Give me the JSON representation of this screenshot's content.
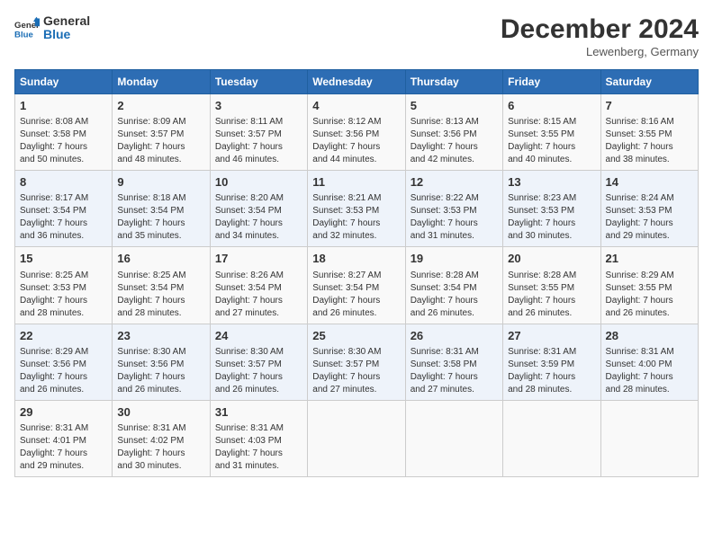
{
  "header": {
    "logo_line1": "General",
    "logo_line2": "Blue",
    "month": "December 2024",
    "location": "Lewenberg, Germany"
  },
  "weekdays": [
    "Sunday",
    "Monday",
    "Tuesday",
    "Wednesday",
    "Thursday",
    "Friday",
    "Saturday"
  ],
  "weeks": [
    [
      {
        "day": "1",
        "lines": [
          "Sunrise: 8:08 AM",
          "Sunset: 3:58 PM",
          "Daylight: 7 hours",
          "and 50 minutes."
        ]
      },
      {
        "day": "2",
        "lines": [
          "Sunrise: 8:09 AM",
          "Sunset: 3:57 PM",
          "Daylight: 7 hours",
          "and 48 minutes."
        ]
      },
      {
        "day": "3",
        "lines": [
          "Sunrise: 8:11 AM",
          "Sunset: 3:57 PM",
          "Daylight: 7 hours",
          "and 46 minutes."
        ]
      },
      {
        "day": "4",
        "lines": [
          "Sunrise: 8:12 AM",
          "Sunset: 3:56 PM",
          "Daylight: 7 hours",
          "and 44 minutes."
        ]
      },
      {
        "day": "5",
        "lines": [
          "Sunrise: 8:13 AM",
          "Sunset: 3:56 PM",
          "Daylight: 7 hours",
          "and 42 minutes."
        ]
      },
      {
        "day": "6",
        "lines": [
          "Sunrise: 8:15 AM",
          "Sunset: 3:55 PM",
          "Daylight: 7 hours",
          "and 40 minutes."
        ]
      },
      {
        "day": "7",
        "lines": [
          "Sunrise: 8:16 AM",
          "Sunset: 3:55 PM",
          "Daylight: 7 hours",
          "and 38 minutes."
        ]
      }
    ],
    [
      {
        "day": "8",
        "lines": [
          "Sunrise: 8:17 AM",
          "Sunset: 3:54 PM",
          "Daylight: 7 hours",
          "and 36 minutes."
        ]
      },
      {
        "day": "9",
        "lines": [
          "Sunrise: 8:18 AM",
          "Sunset: 3:54 PM",
          "Daylight: 7 hours",
          "and 35 minutes."
        ]
      },
      {
        "day": "10",
        "lines": [
          "Sunrise: 8:20 AM",
          "Sunset: 3:54 PM",
          "Daylight: 7 hours",
          "and 34 minutes."
        ]
      },
      {
        "day": "11",
        "lines": [
          "Sunrise: 8:21 AM",
          "Sunset: 3:53 PM",
          "Daylight: 7 hours",
          "and 32 minutes."
        ]
      },
      {
        "day": "12",
        "lines": [
          "Sunrise: 8:22 AM",
          "Sunset: 3:53 PM",
          "Daylight: 7 hours",
          "and 31 minutes."
        ]
      },
      {
        "day": "13",
        "lines": [
          "Sunrise: 8:23 AM",
          "Sunset: 3:53 PM",
          "Daylight: 7 hours",
          "and 30 minutes."
        ]
      },
      {
        "day": "14",
        "lines": [
          "Sunrise: 8:24 AM",
          "Sunset: 3:53 PM",
          "Daylight: 7 hours",
          "and 29 minutes."
        ]
      }
    ],
    [
      {
        "day": "15",
        "lines": [
          "Sunrise: 8:25 AM",
          "Sunset: 3:53 PM",
          "Daylight: 7 hours",
          "and 28 minutes."
        ]
      },
      {
        "day": "16",
        "lines": [
          "Sunrise: 8:25 AM",
          "Sunset: 3:54 PM",
          "Daylight: 7 hours",
          "and 28 minutes."
        ]
      },
      {
        "day": "17",
        "lines": [
          "Sunrise: 8:26 AM",
          "Sunset: 3:54 PM",
          "Daylight: 7 hours",
          "and 27 minutes."
        ]
      },
      {
        "day": "18",
        "lines": [
          "Sunrise: 8:27 AM",
          "Sunset: 3:54 PM",
          "Daylight: 7 hours",
          "and 26 minutes."
        ]
      },
      {
        "day": "19",
        "lines": [
          "Sunrise: 8:28 AM",
          "Sunset: 3:54 PM",
          "Daylight: 7 hours",
          "and 26 minutes."
        ]
      },
      {
        "day": "20",
        "lines": [
          "Sunrise: 8:28 AM",
          "Sunset: 3:55 PM",
          "Daylight: 7 hours",
          "and 26 minutes."
        ]
      },
      {
        "day": "21",
        "lines": [
          "Sunrise: 8:29 AM",
          "Sunset: 3:55 PM",
          "Daylight: 7 hours",
          "and 26 minutes."
        ]
      }
    ],
    [
      {
        "day": "22",
        "lines": [
          "Sunrise: 8:29 AM",
          "Sunset: 3:56 PM",
          "Daylight: 7 hours",
          "and 26 minutes."
        ]
      },
      {
        "day": "23",
        "lines": [
          "Sunrise: 8:30 AM",
          "Sunset: 3:56 PM",
          "Daylight: 7 hours",
          "and 26 minutes."
        ]
      },
      {
        "day": "24",
        "lines": [
          "Sunrise: 8:30 AM",
          "Sunset: 3:57 PM",
          "Daylight: 7 hours",
          "and 26 minutes."
        ]
      },
      {
        "day": "25",
        "lines": [
          "Sunrise: 8:30 AM",
          "Sunset: 3:57 PM",
          "Daylight: 7 hours",
          "and 27 minutes."
        ]
      },
      {
        "day": "26",
        "lines": [
          "Sunrise: 8:31 AM",
          "Sunset: 3:58 PM",
          "Daylight: 7 hours",
          "and 27 minutes."
        ]
      },
      {
        "day": "27",
        "lines": [
          "Sunrise: 8:31 AM",
          "Sunset: 3:59 PM",
          "Daylight: 7 hours",
          "and 28 minutes."
        ]
      },
      {
        "day": "28",
        "lines": [
          "Sunrise: 8:31 AM",
          "Sunset: 4:00 PM",
          "Daylight: 7 hours",
          "and 28 minutes."
        ]
      }
    ],
    [
      {
        "day": "29",
        "lines": [
          "Sunrise: 8:31 AM",
          "Sunset: 4:01 PM",
          "Daylight: 7 hours",
          "and 29 minutes."
        ]
      },
      {
        "day": "30",
        "lines": [
          "Sunrise: 8:31 AM",
          "Sunset: 4:02 PM",
          "Daylight: 7 hours",
          "and 30 minutes."
        ]
      },
      {
        "day": "31",
        "lines": [
          "Sunrise: 8:31 AM",
          "Sunset: 4:03 PM",
          "Daylight: 7 hours",
          "and 31 minutes."
        ]
      },
      {
        "day": "",
        "lines": []
      },
      {
        "day": "",
        "lines": []
      },
      {
        "day": "",
        "lines": []
      },
      {
        "day": "",
        "lines": []
      }
    ]
  ]
}
